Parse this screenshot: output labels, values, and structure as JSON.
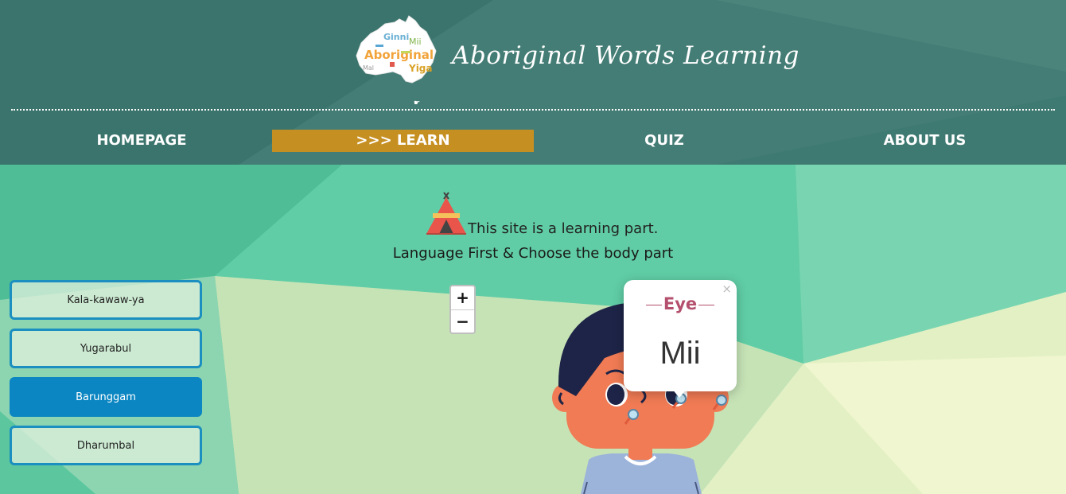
{
  "site": {
    "title": "Aboriginal Words Learning",
    "logo_words": [
      "Ginni",
      "Aboriginal",
      "Mii",
      "Yiga",
      "Mal"
    ]
  },
  "nav": {
    "items": [
      {
        "label": "HOMEPAGE",
        "active": false
      },
      {
        "label": ">>> LEARN",
        "active": true
      },
      {
        "label": "QUIZ",
        "active": false
      },
      {
        "label": "ABOUT US",
        "active": false
      }
    ]
  },
  "intro": {
    "text": "This site is a learning part.",
    "instruction": "Language First & Choose the body part"
  },
  "languages": [
    {
      "label": "Kala-kawaw-ya",
      "active": false
    },
    {
      "label": "Yugarabul",
      "active": false
    },
    {
      "label": "Barunggam",
      "active": true
    },
    {
      "label": "Dharumbal",
      "active": false
    }
  ],
  "zoom": {
    "in_label": "+",
    "out_label": "−"
  },
  "popup": {
    "body_part": "Eye",
    "word": "Mii",
    "close_label": "×"
  },
  "markers": [
    "pin-icon",
    "pin-icon",
    "pin-icon",
    "pin-icon"
  ],
  "colors": {
    "header": "#3f7a72",
    "active_nav": "#c68f22",
    "active_language": "#0b86c2",
    "popup_title": "#b4506e"
  }
}
